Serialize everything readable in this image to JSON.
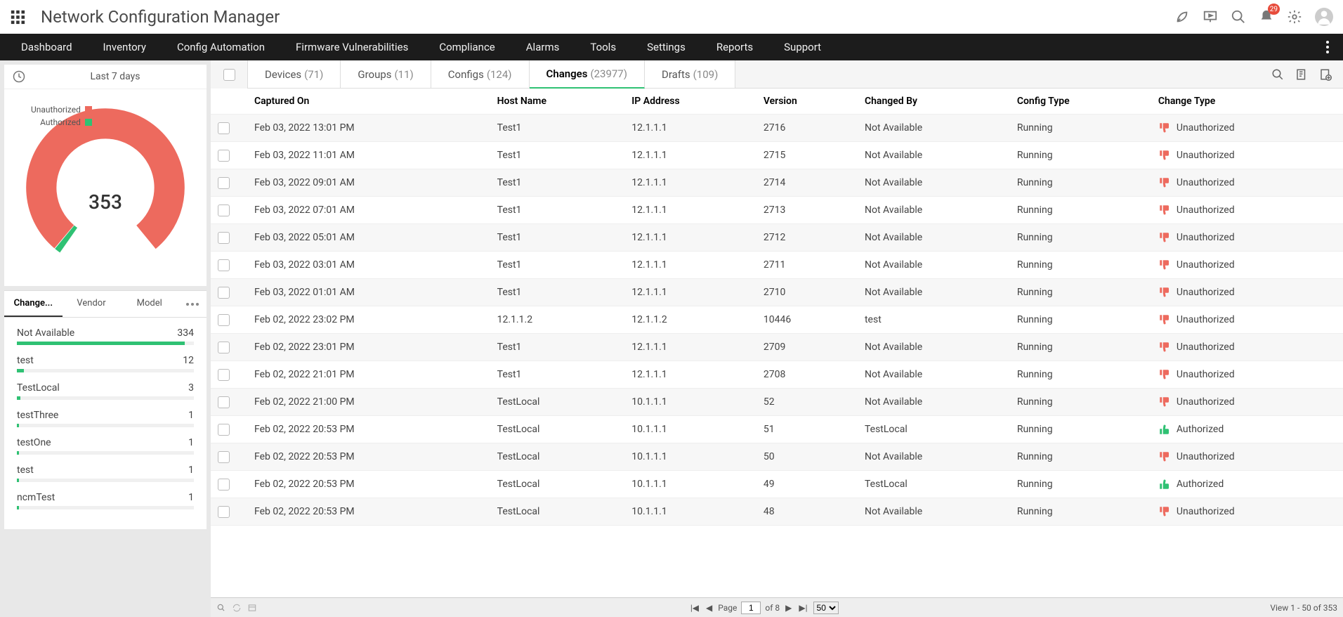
{
  "app_title": "Network Configuration Manager",
  "notification_count": "29",
  "menu": [
    "Dashboard",
    "Inventory",
    "Config Automation",
    "Firmware Vulnerabilities",
    "Compliance",
    "Alarms",
    "Tools",
    "Settings",
    "Reports",
    "Support"
  ],
  "time_filter": "Last 7 days",
  "chart_data": {
    "type": "pie",
    "title": "",
    "total_label": "353",
    "series": [
      {
        "name": "Unauthorized",
        "value": 349,
        "color": "#ed6a5e"
      },
      {
        "name": "Authorized",
        "value": 4,
        "color": "#2fc173"
      }
    ]
  },
  "left_tabs": {
    "t1": "Change...",
    "t2": "Vendor",
    "t3": "Model"
  },
  "bar_items": [
    {
      "name": "Not Available",
      "count": "334",
      "pct": 95
    },
    {
      "name": "test",
      "count": "12",
      "pct": 4
    },
    {
      "name": "TestLocal",
      "count": "3",
      "pct": 2
    },
    {
      "name": "testThree",
      "count": "1",
      "pct": 1
    },
    {
      "name": "testOne",
      "count": "1",
      "pct": 1
    },
    {
      "name": "test",
      "count": "1",
      "pct": 1
    },
    {
      "name": "ncmTest",
      "count": "1",
      "pct": 1
    }
  ],
  "subtabs": [
    {
      "label": "Devices",
      "count": "(71)",
      "active": false
    },
    {
      "label": "Groups",
      "count": "(11)",
      "active": false
    },
    {
      "label": "Configs",
      "count": "(124)",
      "active": false
    },
    {
      "label": "Changes",
      "count": "(23977)",
      "active": true
    },
    {
      "label": "Drafts",
      "count": "(109)",
      "active": false
    }
  ],
  "columns": [
    "Captured On",
    "Host Name",
    "IP Address",
    "Version",
    "Changed By",
    "Config Type",
    "Change Type"
  ],
  "rows": [
    {
      "captured": "Feb 03, 2022 13:01 PM",
      "host": "Test1",
      "ip": "12.1.1.1",
      "ver": "2716",
      "by": "Not Available",
      "cfg": "Running",
      "chg": "Unauthorized",
      "ok": false
    },
    {
      "captured": "Feb 03, 2022 11:01 AM",
      "host": "Test1",
      "ip": "12.1.1.1",
      "ver": "2715",
      "by": "Not Available",
      "cfg": "Running",
      "chg": "Unauthorized",
      "ok": false
    },
    {
      "captured": "Feb 03, 2022 09:01 AM",
      "host": "Test1",
      "ip": "12.1.1.1",
      "ver": "2714",
      "by": "Not Available",
      "cfg": "Running",
      "chg": "Unauthorized",
      "ok": false
    },
    {
      "captured": "Feb 03, 2022 07:01 AM",
      "host": "Test1",
      "ip": "12.1.1.1",
      "ver": "2713",
      "by": "Not Available",
      "cfg": "Running",
      "chg": "Unauthorized",
      "ok": false
    },
    {
      "captured": "Feb 03, 2022 05:01 AM",
      "host": "Test1",
      "ip": "12.1.1.1",
      "ver": "2712",
      "by": "Not Available",
      "cfg": "Running",
      "chg": "Unauthorized",
      "ok": false
    },
    {
      "captured": "Feb 03, 2022 03:01 AM",
      "host": "Test1",
      "ip": "12.1.1.1",
      "ver": "2711",
      "by": "Not Available",
      "cfg": "Running",
      "chg": "Unauthorized",
      "ok": false
    },
    {
      "captured": "Feb 03, 2022 01:01 AM",
      "host": "Test1",
      "ip": "12.1.1.1",
      "ver": "2710",
      "by": "Not Available",
      "cfg": "Running",
      "chg": "Unauthorized",
      "ok": false
    },
    {
      "captured": "Feb 02, 2022 23:02 PM",
      "host": "12.1.1.2",
      "ip": "12.1.1.2",
      "ver": "10446",
      "by": "test",
      "cfg": "Running",
      "chg": "Unauthorized",
      "ok": false
    },
    {
      "captured": "Feb 02, 2022 23:01 PM",
      "host": "Test1",
      "ip": "12.1.1.1",
      "ver": "2709",
      "by": "Not Available",
      "cfg": "Running",
      "chg": "Unauthorized",
      "ok": false
    },
    {
      "captured": "Feb 02, 2022 21:01 PM",
      "host": "Test1",
      "ip": "12.1.1.1",
      "ver": "2708",
      "by": "Not Available",
      "cfg": "Running",
      "chg": "Unauthorized",
      "ok": false
    },
    {
      "captured": "Feb 02, 2022 21:00 PM",
      "host": "TestLocal",
      "ip": "10.1.1.1",
      "ver": "52",
      "by": "Not Available",
      "cfg": "Running",
      "chg": "Unauthorized",
      "ok": false
    },
    {
      "captured": "Feb 02, 2022 20:53 PM",
      "host": "TestLocal",
      "ip": "10.1.1.1",
      "ver": "51",
      "by": "TestLocal",
      "cfg": "Running",
      "chg": "Authorized",
      "ok": true
    },
    {
      "captured": "Feb 02, 2022 20:53 PM",
      "host": "TestLocal",
      "ip": "10.1.1.1",
      "ver": "50",
      "by": "Not Available",
      "cfg": "Running",
      "chg": "Unauthorized",
      "ok": false
    },
    {
      "captured": "Feb 02, 2022 20:53 PM",
      "host": "TestLocal",
      "ip": "10.1.1.1",
      "ver": "49",
      "by": "TestLocal",
      "cfg": "Running",
      "chg": "Authorized",
      "ok": true
    },
    {
      "captured": "Feb 02, 2022 20:53 PM",
      "host": "TestLocal",
      "ip": "10.1.1.1",
      "ver": "48",
      "by": "Not Available",
      "cfg": "Running",
      "chg": "Unauthorized",
      "ok": false
    }
  ],
  "pager": {
    "page_label": "Page",
    "page_value": "1",
    "of_label": "of 8",
    "size": "50",
    "view": "View 1 - 50 of 353"
  }
}
